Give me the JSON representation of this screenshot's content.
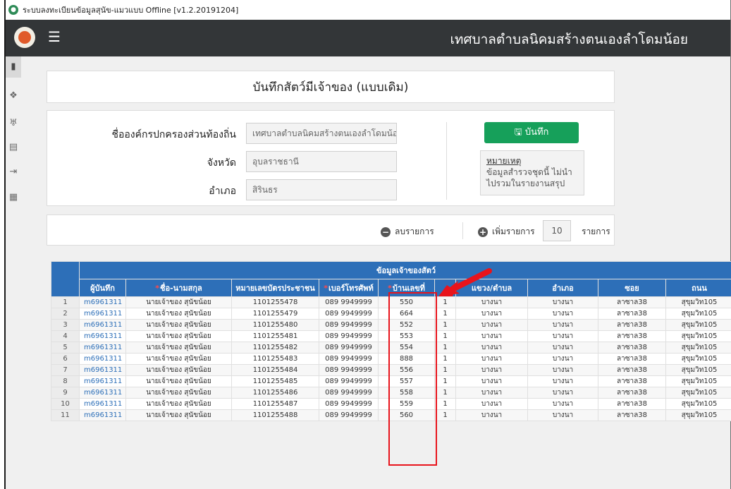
{
  "window": {
    "title": "ระบบลงทะเบียนข้อมูลสุนัข-แมวแบบ Offline [v1.2.20191204]"
  },
  "header": {
    "org_name": "เทศบาลตำบลนิคมสร้างตนเองลำโดมน้อย"
  },
  "sidebar": {
    "icons": [
      "clipboard-icon",
      "paw-icon",
      "dog-bowl-icon",
      "document-icon",
      "logout-icon",
      "report-icon"
    ]
  },
  "page": {
    "title": "บันทึกสัตว์มีเจ้าของ (แบบเดิม)"
  },
  "form": {
    "org_label": "ชื่อองค์กรปกครองส่วนท้องถิ่น",
    "org_value": "เทศบาลตำบลนิคมสร้างตนเองลำโดมน้อ",
    "province_label": "จังหวัด",
    "province_value": "อุบลราชธานี",
    "district_label": "อำเภอ",
    "district_value": "สิรินธร",
    "save_label": "บันทึก",
    "note_heading": "หมายเหตุ",
    "note_text": "ข้อมูลสำรวจชุดนี้ ไม่นำไปรวมในรายงานสรุป"
  },
  "controls": {
    "remove_label": "ลบรายการ",
    "add_label": "เพิ่มรายการ",
    "count_value": "10",
    "count_suffix": "รายการ"
  },
  "table": {
    "group_header": "ข้อมูลเจ้าของสัตว์",
    "columns": [
      "ผู้บันทึก",
      "ชื่อ-นามสกุล",
      "หมายเลขบัตรประชาชน",
      "เบอร์โทรศัพท์",
      "บ้านเลขที่",
      "",
      "แขวง/ตำบล",
      "อำเภอ",
      "ซอย",
      "ถนน"
    ],
    "rows": [
      [
        "1",
        "m6961311",
        "นายเจ้าของ สุนัขน้อย",
        "1101255478",
        "089 9949999",
        "550",
        "1",
        "บางนา",
        "บางนา",
        "ลาซาล38",
        "สุขุมวิท105"
      ],
      [
        "2",
        "m6961311",
        "นายเจ้าของ สุนัขน้อย",
        "1101255479",
        "089 9949999",
        "664",
        "1",
        "บางนา",
        "บางนา",
        "ลาซาล38",
        "สุขุมวิท105"
      ],
      [
        "3",
        "m6961311",
        "นายเจ้าของ สุนัขน้อย",
        "1101255480",
        "089 9949999",
        "552",
        "1",
        "บางนา",
        "บางนา",
        "ลาซาล38",
        "สุขุมวิท105"
      ],
      [
        "4",
        "m6961311",
        "นายเจ้าของ สุนัขน้อย",
        "1101255481",
        "089 9949999",
        "553",
        "1",
        "บางนา",
        "บางนา",
        "ลาซาล38",
        "สุขุมวิท105"
      ],
      [
        "5",
        "m6961311",
        "นายเจ้าของ สุนัขน้อย",
        "1101255482",
        "089 9949999",
        "554",
        "1",
        "บางนา",
        "บางนา",
        "ลาซาล38",
        "สุขุมวิท105"
      ],
      [
        "6",
        "m6961311",
        "นายเจ้าของ สุนัขน้อย",
        "1101255483",
        "089 9949999",
        "888",
        "1",
        "บางนา",
        "บางนา",
        "ลาซาล38",
        "สุขุมวิท105"
      ],
      [
        "7",
        "m6961311",
        "นายเจ้าของ สุนัขน้อย",
        "1101255484",
        "089 9949999",
        "556",
        "1",
        "บางนา",
        "บางนา",
        "ลาซาล38",
        "สุขุมวิท105"
      ],
      [
        "8",
        "m6961311",
        "นายเจ้าของ สุนัขน้อย",
        "1101255485",
        "089 9949999",
        "557",
        "1",
        "บางนา",
        "บางนา",
        "ลาซาล38",
        "สุขุมวิท105"
      ],
      [
        "9",
        "m6961311",
        "นายเจ้าของ สุนัขน้อย",
        "1101255486",
        "089 9949999",
        "558",
        "1",
        "บางนา",
        "บางนา",
        "ลาซาล38",
        "สุขุมวิท105"
      ],
      [
        "10",
        "m6961311",
        "นายเจ้าของ สุนัขน้อย",
        "1101255487",
        "089 9949999",
        "559",
        "1",
        "บางนา",
        "บางนา",
        "ลาซาล38",
        "สุขุมวิท105"
      ],
      [
        "11",
        "m6961311",
        "นายเจ้าของ สุนัขน้อย",
        "1101255488",
        "089 9949999",
        "560",
        "1",
        "บางนา",
        "บางนา",
        "ลาซาล38",
        "สุขุมวิท105"
      ]
    ]
  },
  "colors": {
    "topbar": "#333638",
    "save_button": "#16a05a",
    "table_header": "#2d6fb8",
    "highlight": "#e8141c"
  }
}
